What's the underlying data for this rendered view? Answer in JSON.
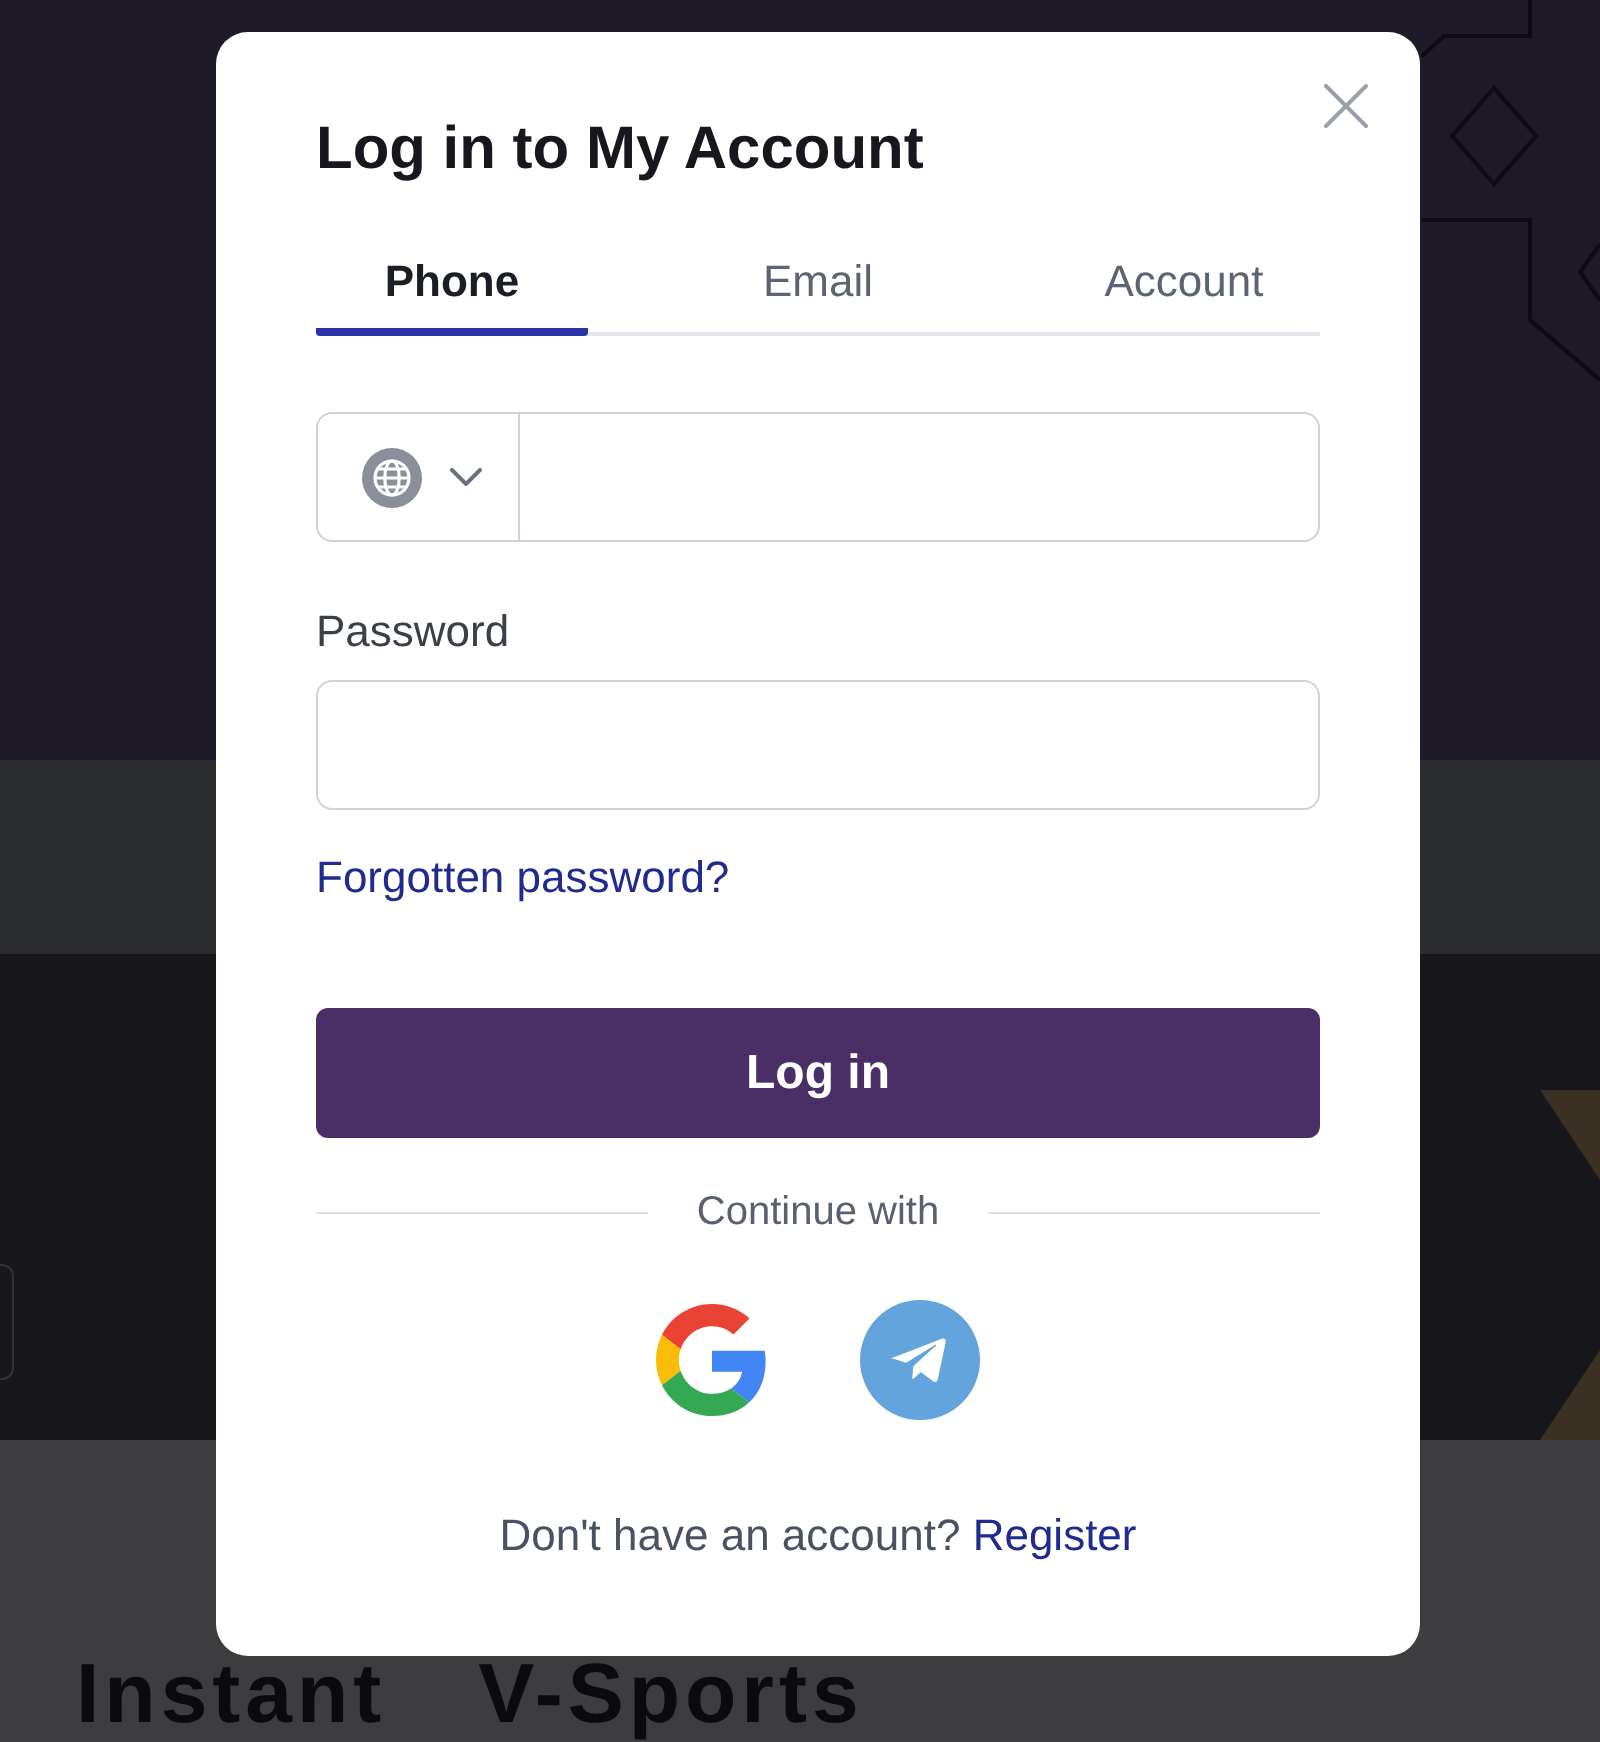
{
  "background": {
    "section_titles": [
      "Instant",
      "V-Sports"
    ]
  },
  "dialog": {
    "title": "Log in to My Account",
    "tabs": [
      {
        "label": "Phone",
        "selected": true
      },
      {
        "label": "Email",
        "selected": false
      },
      {
        "label": "Account",
        "selected": false
      }
    ],
    "fields": [
      {
        "kind": "phone"
      },
      {
        "kind": "password",
        "label": "Password"
      }
    ],
    "forgot_link": "Forgotten password?",
    "submit_button": "Log in",
    "divider_text": "Continue with",
    "social_buttons": [
      {
        "kind": "google"
      },
      {
        "kind": "telegram"
      }
    ],
    "footer": {
      "text": "Don't have an account?",
      "link": "Register"
    }
  }
}
